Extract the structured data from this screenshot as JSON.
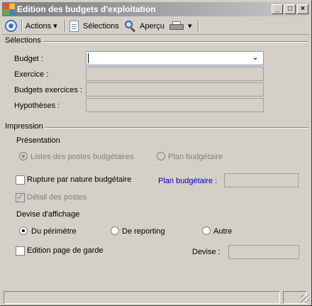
{
  "window": {
    "title": "Edition des budgets d'exploitation"
  },
  "titlebar_buttons": {
    "minimize": "_",
    "maximize": "□",
    "close": "×"
  },
  "toolbar": {
    "actions_label": "Actions",
    "actions_arrow": "▾",
    "selections_label": "Sélections",
    "apercu_label": "Aperçu",
    "print_arrow": "▾"
  },
  "selections": {
    "header": "Sélections",
    "budget_label": "Budget :",
    "budget_value": "",
    "budget_dropdown_icon": "⌄",
    "exercice_label": "Exercice :",
    "budgets_exercices_label": "Budgets exercices :",
    "hypotheses_label": "Hypothèses :"
  },
  "impression": {
    "header": "Impression",
    "presentation_label": "Présentation",
    "radio_listes": "Listes des postes budgétaires",
    "radio_plan": "Plan budgétaire",
    "rupture_label": "Rupture par nature budgétaire",
    "plan_budgetaire_label": "Plan budgétaire :",
    "detail_postes_label": "Détail des postes",
    "detail_postes_mark": "✓",
    "devise_affichage_label": "Devise d'affichage",
    "radio_perimetre": "Du périmètre",
    "radio_reporting": "De reporting",
    "radio_autre": "Autre",
    "edition_garde_label": "Edition page de garde",
    "devise_label": "Devise :"
  },
  "colors": {
    "title_gradient_start": "#7b7b7b",
    "title_gradient_end": "#c8c8c8",
    "face": "#d4d0c8",
    "link_blue": "#0000c0"
  }
}
